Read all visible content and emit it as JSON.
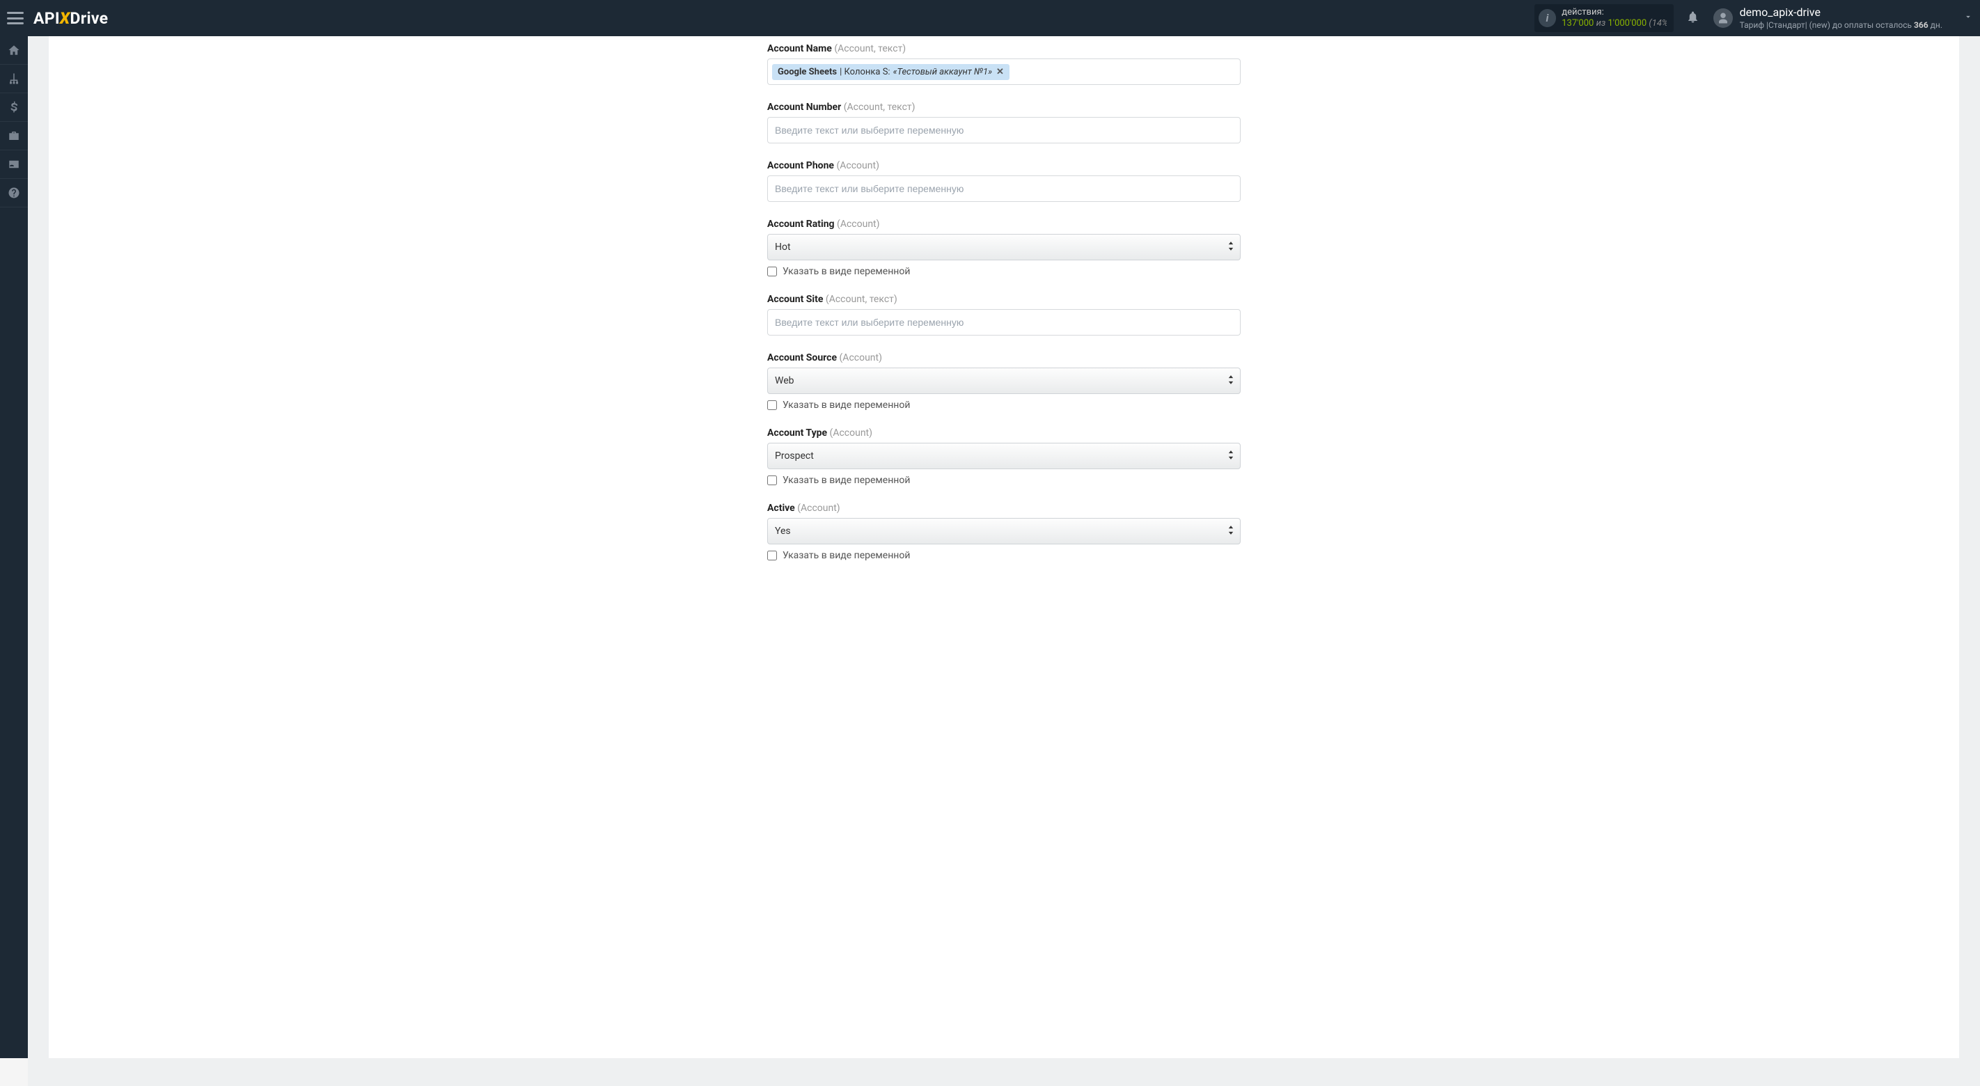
{
  "header": {
    "logo_api": "API",
    "logo_x": "X",
    "logo_drive": "Drive",
    "actions_label": "действия:",
    "actions_used": "137'000",
    "actions_of": "из",
    "actions_total": "1'000'000",
    "actions_pct": "(14%",
    "username": "demo_apix-drive",
    "tariff_prefix": "Тариф |Стандарт| (new) до оплаты осталось ",
    "tariff_days": "366",
    "tariff_suffix": " дн."
  },
  "form": {
    "placeholder_text": "Введите текст или выберите переменную",
    "checkbox_label": "Указать в виде переменной",
    "fields": {
      "accountName": {
        "label": "Account Name",
        "hint": "(Account, текст)",
        "tag_source": "Google Sheets",
        "tag_col": " | Колонка S: ",
        "tag_value": "«Тестовый аккаунт №1»"
      },
      "accountNumber": {
        "label": "Account Number",
        "hint": "(Account, текст)"
      },
      "accountPhone": {
        "label": "Account Phone",
        "hint": "(Account)"
      },
      "accountRating": {
        "label": "Account Rating",
        "hint": "(Account)",
        "value": "Hot"
      },
      "accountSite": {
        "label": "Account Site",
        "hint": "(Account, текст)"
      },
      "accountSource": {
        "label": "Account Source",
        "hint": "(Account)",
        "value": "Web"
      },
      "accountType": {
        "label": "Account Type",
        "hint": "(Account)",
        "value": "Prospect"
      },
      "active": {
        "label": "Active",
        "hint": "(Account)",
        "value": "Yes"
      }
    }
  }
}
